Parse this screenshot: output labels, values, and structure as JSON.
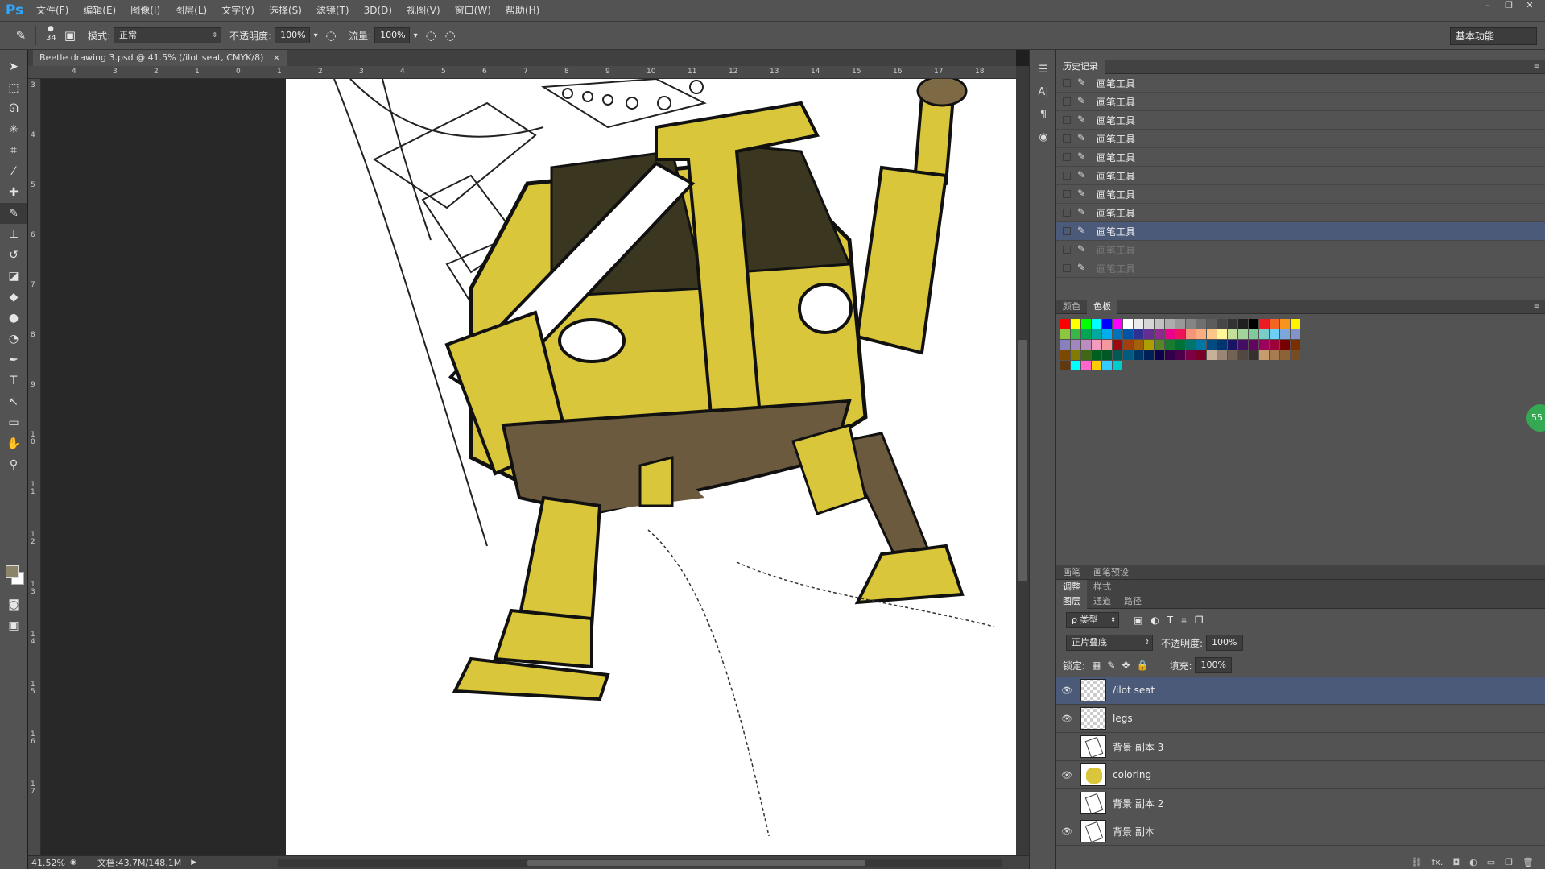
{
  "app": {
    "logo": "Ps",
    "menu": [
      "文件(F)",
      "编辑(E)",
      "图像(I)",
      "图层(L)",
      "文字(Y)",
      "选择(S)",
      "滤镜(T)",
      "3D(D)",
      "视图(V)",
      "窗口(W)",
      "帮助(H)"
    ],
    "window_controls": [
      "–",
      "❐",
      "✕"
    ]
  },
  "options": {
    "brush_size": "34",
    "mode_label": "模式:",
    "mode_value": "正常",
    "opacity_label": "不透明度:",
    "opacity_value": "100%",
    "flow_label": "流量:",
    "flow_value": "100%",
    "workspace": "基本功能"
  },
  "document": {
    "tab_title": "Beetle drawing 3.psd @ 41.5% (/ilot seat, CMYK/8)",
    "tab_close": "×",
    "ruler_top_ticks": [
      "4",
      "3",
      "2",
      "1",
      "0",
      "1",
      "2",
      "3",
      "4",
      "5",
      "6",
      "7",
      "8",
      "9",
      "10",
      "11",
      "12",
      "13",
      "14",
      "15",
      "16",
      "17",
      "18"
    ],
    "ruler_left_ticks": [
      "3",
      "4",
      "5",
      "6",
      "7",
      "8",
      "9",
      "1 0",
      "1 1",
      "1 2",
      "1 3",
      "1 4",
      "1 5",
      "1 6",
      "1 7"
    ]
  },
  "status": {
    "zoom": "41.52%",
    "doc_info": "文档:43.7M/148.1M"
  },
  "history": {
    "tab": "历史记录",
    "items": [
      {
        "label": "画笔工具",
        "state": "normal"
      },
      {
        "label": "画笔工具",
        "state": "normal"
      },
      {
        "label": "画笔工具",
        "state": "normal"
      },
      {
        "label": "画笔工具",
        "state": "normal"
      },
      {
        "label": "画笔工具",
        "state": "normal"
      },
      {
        "label": "画笔工具",
        "state": "normal"
      },
      {
        "label": "画笔工具",
        "state": "normal"
      },
      {
        "label": "画笔工具",
        "state": "normal"
      },
      {
        "label": "画笔工具",
        "state": "active"
      },
      {
        "label": "画笔工具",
        "state": "dim"
      },
      {
        "label": "画笔工具",
        "state": "dim"
      }
    ]
  },
  "swatch_panel": {
    "tabs": [
      "颜色",
      "色板"
    ],
    "colors": [
      "#ff0000",
      "#ffff00",
      "#00ff00",
      "#00ffff",
      "#0000ff",
      "#ff00ff",
      "#ffffff",
      "#ebebeb",
      "#d6d6d6",
      "#c2c2c2",
      "#adadad",
      "#999999",
      "#858585",
      "#707070",
      "#5c5c5c",
      "#474747",
      "#333333",
      "#1f1f1f",
      "#000000",
      "#ed1c24",
      "#f26522",
      "#f7941d",
      "#fff200",
      "#8dc63f",
      "#39b54a",
      "#00a651",
      "#00a99d",
      "#00aeef",
      "#0072bc",
      "#0054a6",
      "#2e3192",
      "#662d91",
      "#92278f",
      "#ec008c",
      "#ed145b",
      "#f69679",
      "#f9ad81",
      "#fdc689",
      "#fff799",
      "#c4df9b",
      "#a3d39c",
      "#82ca9c",
      "#7accc8",
      "#6dcff6",
      "#7da7d9",
      "#8393ca",
      "#8781bd",
      "#a187be",
      "#bd8cbf",
      "#f49ac1",
      "#f5989d",
      "#9e0b0f",
      "#a0410d",
      "#a36209",
      "#aba000",
      "#598527",
      "#1a7b30",
      "#007236",
      "#00746b",
      "#0076a3",
      "#004b80",
      "#003471",
      "#1b1464",
      "#440e62",
      "#630460",
      "#9e005d",
      "#9e0039",
      "#790000",
      "#7b2e00",
      "#7d4900",
      "#827b00",
      "#406618",
      "#005e20",
      "#005826",
      "#005952",
      "#005b7f",
      "#003663",
      "#002157",
      "#0d004c",
      "#32004b",
      "#4b0049",
      "#7b0046",
      "#7a0026",
      "#c7b299",
      "#998675",
      "#736357",
      "#534741",
      "#37302d",
      "#c69c6d",
      "#a67c52",
      "#8c6239",
      "#754c24",
      "#603913",
      "#00ffff",
      "#ff66cc",
      "#ffcc00",
      "#33ccff",
      "#00cccc"
    ]
  },
  "adjust_tabs": [
    "画笔",
    "画笔预设"
  ],
  "adjust_tabs2": [
    "调整",
    "样式"
  ],
  "layers": {
    "tabs": [
      "图层",
      "通道",
      "路径"
    ],
    "filter": "ρ 类型",
    "blend": "正片叠底",
    "opacity_label": "不透明度:",
    "opacity": "100%",
    "lock_label": "锁定:",
    "fill_label": "填充:",
    "fill": "100%",
    "items": [
      {
        "name": "/ilot seat",
        "visible": true,
        "thumb": "checker",
        "active": true
      },
      {
        "name": "legs",
        "visible": true,
        "thumb": "checker",
        "active": false
      },
      {
        "name": "背景 副本 3",
        "visible": false,
        "thumb": "sketch",
        "active": false
      },
      {
        "name": "coloring",
        "visible": true,
        "thumb": "yellow",
        "active": false
      },
      {
        "name": "背景 副本 2",
        "visible": false,
        "thumb": "sketch",
        "active": false
      },
      {
        "name": "背景 副本",
        "visible": true,
        "thumb": "sketch",
        "active": false
      }
    ],
    "footer_icons": [
      "link-icon",
      "fx-icon",
      "mask-icon",
      "adjustment-icon",
      "folder-icon",
      "new-layer-icon",
      "trash-icon"
    ],
    "footer_glyphs": [
      "⛓",
      "fx.",
      "◘",
      "◐",
      "▭",
      "❒",
      "🗑"
    ]
  },
  "badge": "55",
  "colors": {
    "panel_bg": "#535353",
    "active_row": "#4b5a78",
    "robot_yellow": "#d9c63a",
    "robot_brown": "#6b5a3e",
    "window_dark": "#3a3620"
  }
}
